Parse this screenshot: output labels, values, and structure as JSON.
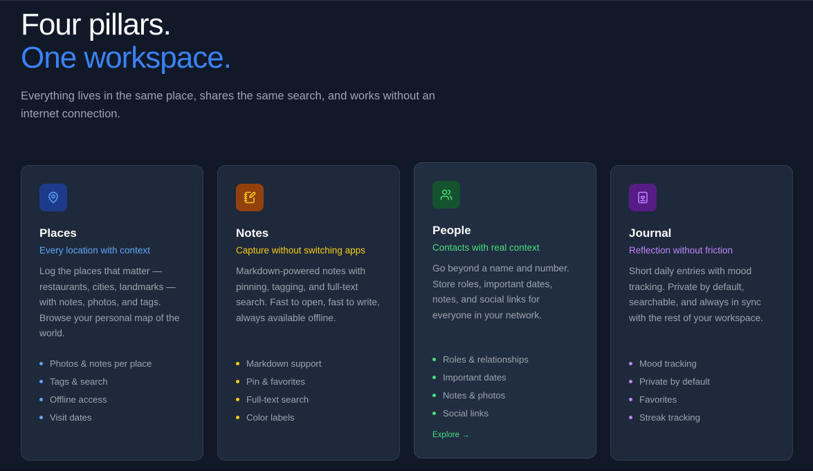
{
  "hero": {
    "title_line1": "Four pillars.",
    "title_line2": "One workspace.",
    "subtitle": "Everything lives in the same place, shares the same search, and works without an internet connection."
  },
  "cards": [
    {
      "icon": "map-pin-icon",
      "title": "Places",
      "tagline": "Every location with context",
      "description": "Log the places that matter — restaurants, cities, landmarks — with notes, photos, and tags. Browse your personal map of the world.",
      "features": [
        "Photos & notes per place",
        "Tags & search",
        "Offline access",
        "Visit dates"
      ],
      "accent": "#60a5fa",
      "icon_bg": "#1e3a8a"
    },
    {
      "icon": "notebook-pen-icon",
      "title": "Notes",
      "tagline": "Capture without switching apps",
      "description": "Markdown-powered notes with pinning, tagging, and full-text search. Fast to open, fast to write, always available offline.",
      "features": [
        "Markdown support",
        "Pin & favorites",
        "Full-text search",
        "Color labels"
      ],
      "accent": "#facc15",
      "icon_bg": "#92400e"
    },
    {
      "icon": "users-icon",
      "title": "People",
      "tagline": "Contacts with real context",
      "description": "Go beyond a name and number. Store roles, important dates, notes, and social links for everyone in your network.",
      "features": [
        "Roles & relationships",
        "Important dates",
        "Notes & photos",
        "Social links"
      ],
      "accent": "#4ade80",
      "icon_bg": "#14532d",
      "explore": "Explore →"
    },
    {
      "icon": "journal-heart-icon",
      "title": "Journal",
      "tagline": "Reflection without friction",
      "description": "Short daily entries with mood tracking. Private by default, searchable, and always in sync with the rest of your workspace.",
      "features": [
        "Mood tracking",
        "Private by default",
        "Favorites",
        "Streak tracking"
      ],
      "accent": "#c084fc",
      "icon_bg": "#581c87"
    }
  ]
}
